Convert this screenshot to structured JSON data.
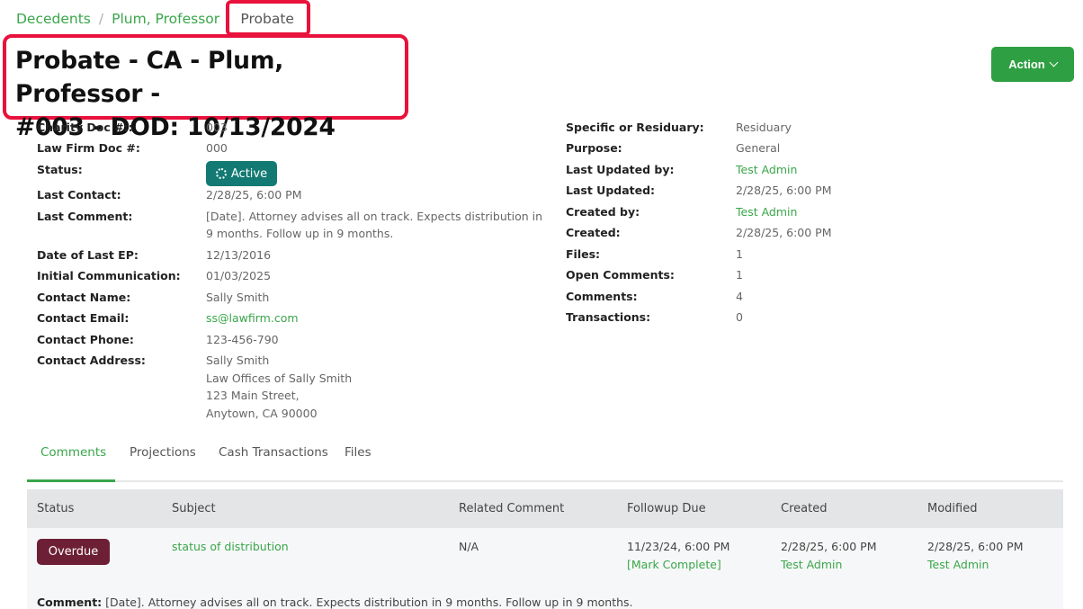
{
  "breadcrumb": {
    "items": [
      "Decedents",
      "Plum, Professor"
    ],
    "separator": "/",
    "current": "Probate"
  },
  "page": {
    "title": "Probate - CA - Plum, Professor - #003 - DOD: 10/13/2024",
    "title_line1": "Probate - CA - Plum, Professor -",
    "title_line2": "#003 - DOD: 10/13/2024"
  },
  "action_label": "Action",
  "left_fields": {
    "charity_doc_label": "Charity Doc #::",
    "charity_doc": "003",
    "law_firm_doc_label": "Law Firm Doc #:",
    "law_firm_doc": "000",
    "status_label": "Status:",
    "status": "Active",
    "last_contact_label": "Last Contact:",
    "last_contact": "2/28/25, 6:00 PM",
    "last_comment_label": "Last Comment:",
    "last_comment_1": "[Date]. Attorney advises all on track. Expects distribution in",
    "last_comment_2": "9 months. Follow up in 9 months.",
    "date_last_ep_label": "Date of Last EP:",
    "date_last_ep": "12/13/2016",
    "initial_comm_label": "Initial Communication:",
    "initial_comm": "01/03/2025",
    "contact_name_label": "Contact Name:",
    "contact_name": "Sally Smith",
    "contact_email_label": "Contact Email:",
    "contact_email": "ss@lawfirm.com",
    "contact_phone_label": "Contact Phone:",
    "contact_phone": "123-456-790",
    "contact_address_label": "Contact Address:",
    "address_lines": [
      "Sally Smith",
      "Law Offices of Sally Smith",
      "123 Main Street,",
      "Anytown, CA 90000"
    ]
  },
  "right_fields": {
    "specific_label": "Specific or Residuary:",
    "specific": "Residuary",
    "purpose_label": "Purpose:",
    "purpose": "General",
    "last_updated_by_label": "Last Updated by:",
    "last_updated_by": "Test Admin",
    "last_updated_label": "Last Updated:",
    "last_updated": "2/28/25, 6:00 PM",
    "created_by_label": "Created by:",
    "created_by": "Test Admin",
    "created_label": "Created:",
    "created": "2/28/25, 6:00 PM",
    "files_label": "Files:",
    "files": "1",
    "open_comments_label": "Open Comments:",
    "open_comments": "1",
    "comments_label": "Comments:",
    "comments": "4",
    "transactions_label": "Transactions:",
    "transactions": "0"
  },
  "tabs": [
    "Comments",
    "Projections",
    "Cash Transactions",
    "Files"
  ],
  "table": {
    "headers": [
      "Status",
      "Subject",
      "Related Comment",
      "Followup Due",
      "Created",
      "Modified"
    ],
    "row": {
      "status": "Overdue",
      "subject": "status of distribution",
      "related": "N/A",
      "followup_due": "11/23/24, 6:00 PM",
      "mark_complete": "[Mark Complete]",
      "created": "2/28/25, 6:00 PM",
      "created_by": "Test Admin",
      "modified": "2/28/25, 6:00 PM",
      "modified_by": "Test Admin",
      "comment_label": "Comment:",
      "comment_text": "[Date]. Attorney advises all on track. Expects distribution in 9 months. Follow up in 9 months."
    }
  },
  "colors": {
    "accent": "#3aa64a",
    "action_bg": "#2ea043",
    "status_active": "#137a73",
    "overdue": "#6d1f36",
    "highlight": "#e8123c"
  }
}
